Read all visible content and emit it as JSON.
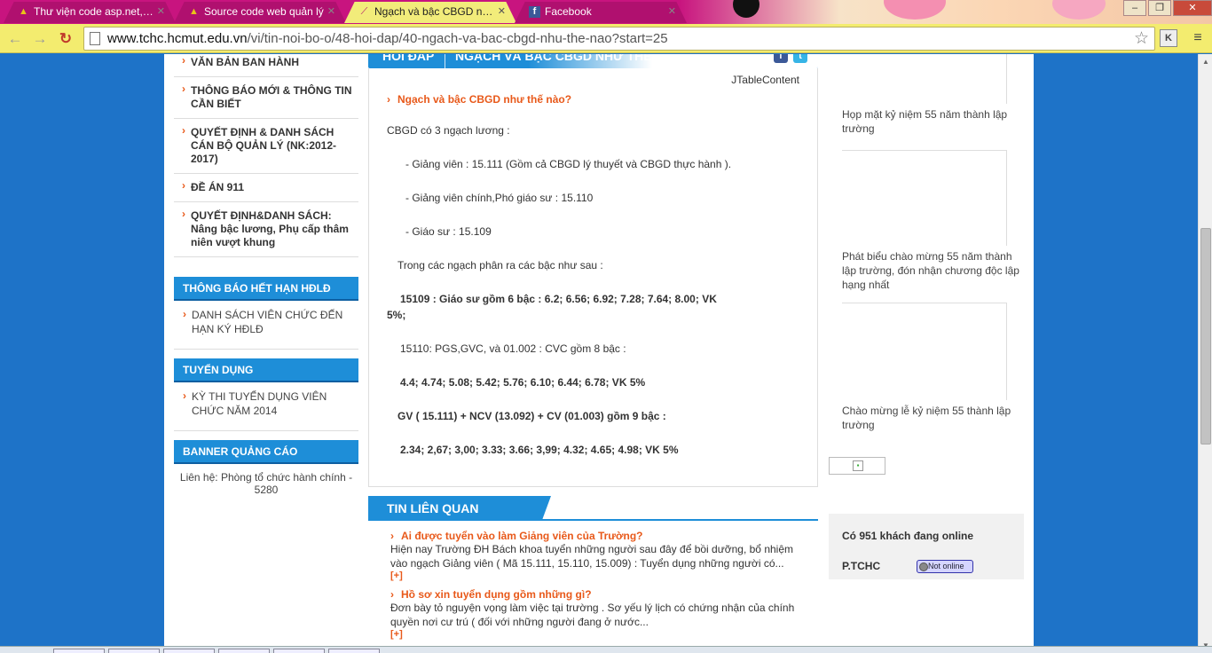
{
  "browser": {
    "tabs": [
      {
        "title": "Thư viện code asp.net, mã",
        "icon": "site-favicon",
        "active": false
      },
      {
        "title": "Source code web quản lý",
        "icon": "site-favicon",
        "active": false
      },
      {
        "title": "Ngạch và bậc CBGD như t",
        "icon": "site-favicon",
        "active": true
      },
      {
        "title": "Facebook",
        "icon": "facebook-favicon",
        "active": false
      }
    ],
    "url_host": "www.tchc.hcmut.edu.vn",
    "url_path": "/vi/tin-noi-bo-o/48-hoi-dap/40-ngach-va-bac-cbgd-nhu-the-nao?start=25",
    "extension_label": "K",
    "colors": {
      "tabbar": "#c8147f",
      "toolbar": "#f3ec6f"
    }
  },
  "sidebar": {
    "menu_items": [
      {
        "label": "VĂN BẢN BAN HÀNH"
      },
      {
        "label": "THÔNG BÁO MỚI & THÔNG TIN CẦN BIẾT"
      },
      {
        "label": "QUYẾT ĐỊNH & DANH SÁCH CÁN BỘ QUẢN LÝ (NK:2012-2017)"
      },
      {
        "label": "ĐỀ ÁN 911"
      },
      {
        "label": "QUYẾT ĐỊNH&DANH SÁCH: Nâng bậc lương, Phụ cấp thâm niên vượt khung"
      }
    ],
    "box_expired": {
      "title": "THÔNG BÁO HẾT HẠN HĐLĐ",
      "item": "DANH SÁCH VIÊN CHỨC ĐẾN HẠN KÝ HĐLĐ"
    },
    "box_recruit": {
      "title": "TUYỂN DỤNG",
      "item": "KỲ THI TUYỂN DỤNG VIÊN CHỨC NĂM 2014"
    },
    "box_banner": {
      "title": "BANNER QUẢNG CÁO",
      "contact": "Liên hệ: Phòng tổ chức hành chính - 5280"
    }
  },
  "article": {
    "band_left": "HỎI ĐÁP",
    "band_title": "NGẠCH VÀ BẬC CBGD NHƯ THẾ NÀO",
    "component_label": "JTableContent",
    "title": "Ngạch và bậc CBGD như thế nào?",
    "lines": [
      "CBGD có 3 ngạch lương :",
      "- Giảng viên : 15.111 (Gồm cả  CBGD lý thuyết và CBGD thực hành ).",
      "- Giảng viên chính,Phó giáo sư : 15.110",
      "- Giáo sư : 15.109",
      "Trong các ngạch phân ra các bậc như sau :",
      "15109 : Giáo sư gồm 6 bậc   :   6.2;    6.56;   6.92;    7.28;    7.64;      8.00;     VK",
      "5%;",
      "15110: PGS,GVC, và 01.002 : CVC  gồm 8 bậc :",
      "4.4;   4.74;   5.08;    5.42;    5.76;   6.10;    6.44;   6.78;     VK 5%",
      "GV ( 15.111) + NCV (13.092) + CV (01.003) gồm 9 bậc :",
      "2.34;     2,67;  3,00;  3.33;     3.66;     3,99;   4.32;     4.65;  4.98;   VK 5%"
    ]
  },
  "related": {
    "heading": "TIN LIÊN QUAN",
    "items": [
      {
        "title": "Ai được tuyển vào làm Giảng viên của Trường?",
        "desc": "Hiện nay Trường ĐH Bách khoa tuyển những người sau đây để bồi dưỡng, bổ nhiệm vào ngạch Giảng viên ( Mã 15.111, 15.110, 15.009) : Tuyển dụng những người có...",
        "more": "[+]"
      },
      {
        "title": "Hồ sơ xin tuyển dụng gồm những gì?",
        "desc": "Đơn bày tỏ nguyện vọng làm việc tại trường . Sơ yếu lý lịch có chứng nhận của chính quyền nơi cư trú ( đối với những người đang ở nước...",
        "more": "[+]"
      }
    ]
  },
  "right": {
    "captions": [
      "Họp mặt kỷ niệm 55 năm thành lập trường",
      "Phát biểu chào mừng 55 năm thành lập trường, đón nhận chương độc lập hạng nhất",
      "Chào mừng lễ kỷ niệm 55 thành lập trường"
    ],
    "online_text": "Có 951 khách đang online",
    "dept": "P.TCHC",
    "status": "Not online"
  }
}
